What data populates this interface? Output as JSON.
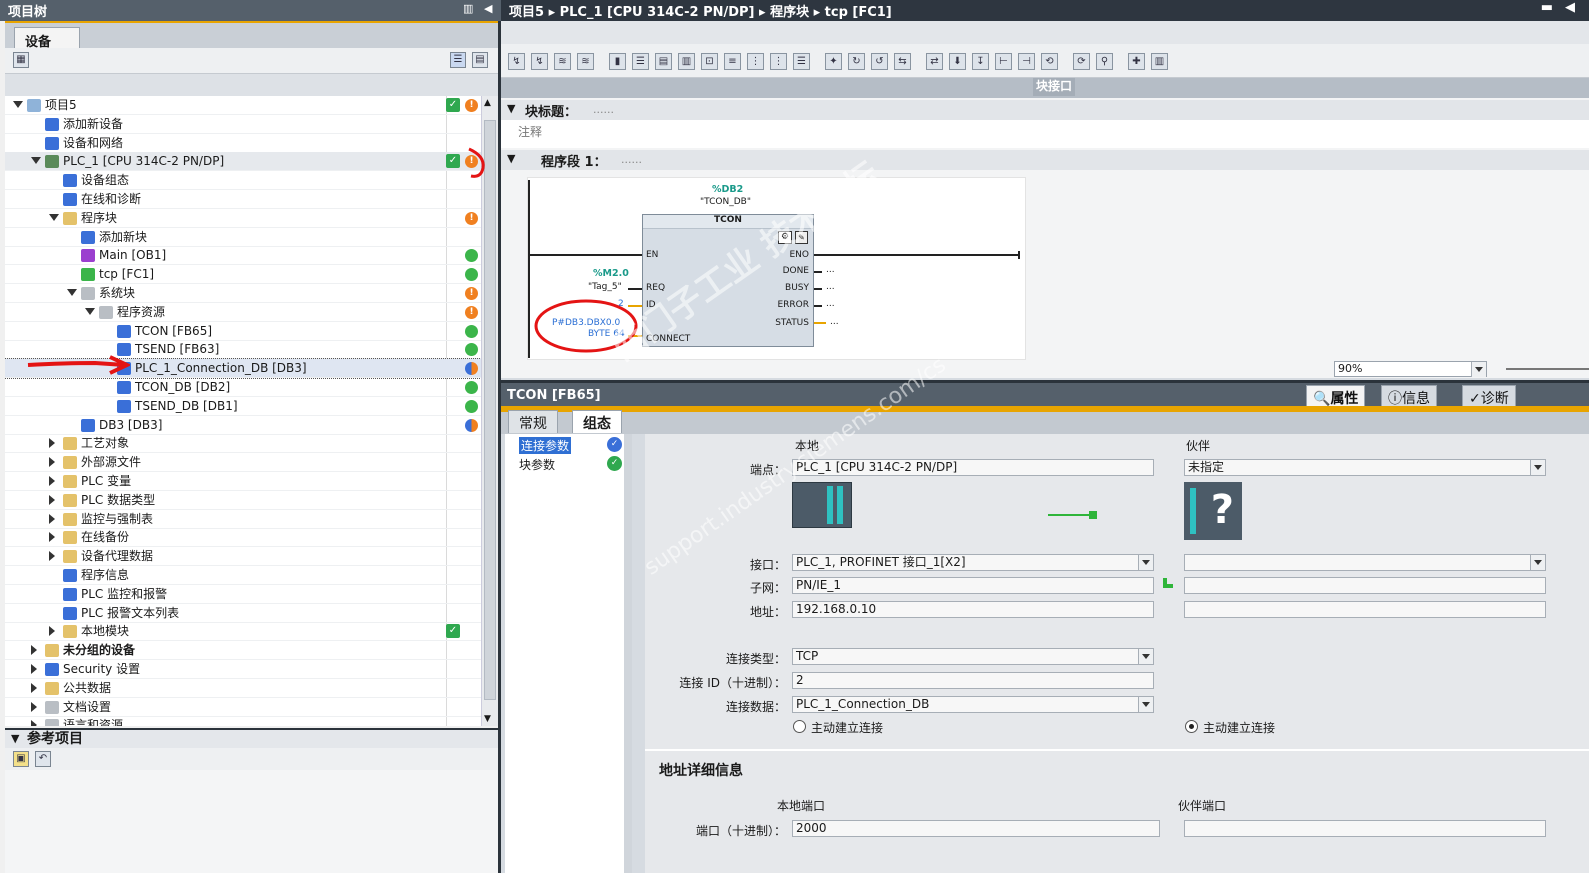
{
  "left": {
    "title": "项目树",
    "tab": "设备",
    "tree": [
      {
        "label": "项目5",
        "indent": 0,
        "tw": "open",
        "icon": "project-icon",
        "icolor": "#8fb3d9",
        "st": "chk",
        "st2": "warn"
      },
      {
        "label": "添加新设备",
        "indent": 1,
        "tw": "",
        "icon": "add-device-icon",
        "icolor": "#3a6fd8",
        "st": "",
        "st2": ""
      },
      {
        "label": "设备和网络",
        "indent": 1,
        "tw": "",
        "icon": "network-icon",
        "icolor": "#3a6fd8",
        "st": "",
        "st2": ""
      },
      {
        "label": "PLC_1 [CPU 314C-2 PN/DP]",
        "indent": 1,
        "tw": "open",
        "icon": "plc-icon",
        "icolor": "#5a8a5a",
        "st": "chk",
        "st2": "warn",
        "sel": true
      },
      {
        "label": "设备组态",
        "indent": 2,
        "tw": "",
        "icon": "device-config-icon",
        "icolor": "#3a6fd8",
        "st": "",
        "st2": ""
      },
      {
        "label": "在线和诊断",
        "indent": 2,
        "tw": "",
        "icon": "online-diag-icon",
        "icolor": "#3a6fd8",
        "st": "",
        "st2": ""
      },
      {
        "label": "程序块",
        "indent": 2,
        "tw": "open",
        "icon": "folder-icon",
        "icolor": "#e4c26a",
        "st": "",
        "st2": "warn"
      },
      {
        "label": "添加新块",
        "indent": 3,
        "tw": "",
        "icon": "add-block-icon",
        "icolor": "#3a6fd8",
        "st": "",
        "st2": ""
      },
      {
        "label": "Main [OB1]",
        "indent": 3,
        "tw": "",
        "icon": "ob-icon",
        "icolor": "#9b3fcf",
        "st": "",
        "st2": "ok"
      },
      {
        "label": "tcp [FC1]",
        "indent": 3,
        "tw": "",
        "icon": "fc-icon",
        "icolor": "#3bb54a",
        "st": "",
        "st2": "ok"
      },
      {
        "label": "系统块",
        "indent": 3,
        "tw": "open",
        "icon": "folder-icon",
        "icolor": "#b9bec4",
        "st": "",
        "st2": "warn"
      },
      {
        "label": "程序资源",
        "indent": 4,
        "tw": "open",
        "icon": "folder-icon",
        "icolor": "#b9bec4",
        "st": "",
        "st2": "warn"
      },
      {
        "label": "TCON [FB65]",
        "indent": 5,
        "tw": "",
        "icon": "fb-icon",
        "icolor": "#3a6fd8",
        "st": "",
        "st2": "ok"
      },
      {
        "label": "TSEND [FB63]",
        "indent": 5,
        "tw": "",
        "icon": "fb-icon",
        "icolor": "#3a6fd8",
        "st": "",
        "st2": "ok"
      },
      {
        "label": "PLC_1_Connection_DB [DB3]",
        "indent": 5,
        "tw": "",
        "icon": "db-icon",
        "icolor": "#3a6fd8",
        "st": "",
        "st2": "half",
        "dash": true
      },
      {
        "label": "TCON_DB [DB2]",
        "indent": 5,
        "tw": "",
        "icon": "db-icon",
        "icolor": "#3a6fd8",
        "st": "",
        "st2": "ok"
      },
      {
        "label": "TSEND_DB [DB1]",
        "indent": 5,
        "tw": "",
        "icon": "db-icon",
        "icolor": "#3a6fd8",
        "st": "",
        "st2": "ok"
      },
      {
        "label": "DB3 [DB3]",
        "indent": 3,
        "tw": "",
        "icon": "db-icon",
        "icolor": "#3a6fd8",
        "st": "",
        "st2": "half"
      },
      {
        "label": "工艺对象",
        "indent": 2,
        "tw": "closed",
        "icon": "folder-icon",
        "icolor": "#e4c26a",
        "st": "",
        "st2": ""
      },
      {
        "label": "外部源文件",
        "indent": 2,
        "tw": "closed",
        "icon": "folder-icon",
        "icolor": "#e4c26a",
        "st": "",
        "st2": ""
      },
      {
        "label": "PLC 变量",
        "indent": 2,
        "tw": "closed",
        "icon": "folder-icon",
        "icolor": "#e4c26a",
        "st": "",
        "st2": ""
      },
      {
        "label": "PLC 数据类型",
        "indent": 2,
        "tw": "closed",
        "icon": "folder-icon",
        "icolor": "#e4c26a",
        "st": "",
        "st2": ""
      },
      {
        "label": "监控与强制表",
        "indent": 2,
        "tw": "closed",
        "icon": "folder-icon",
        "icolor": "#e4c26a",
        "st": "",
        "st2": ""
      },
      {
        "label": "在线备份",
        "indent": 2,
        "tw": "closed",
        "icon": "folder-icon",
        "icolor": "#e4c26a",
        "st": "",
        "st2": ""
      },
      {
        "label": "设备代理数据",
        "indent": 2,
        "tw": "closed",
        "icon": "folder-icon",
        "icolor": "#e4c26a",
        "st": "",
        "st2": ""
      },
      {
        "label": "程序信息",
        "indent": 2,
        "tw": "",
        "icon": "info-icon",
        "icolor": "#3a6fd8",
        "st": "",
        "st2": ""
      },
      {
        "label": "PLC 监控和报警",
        "indent": 2,
        "tw": "",
        "icon": "alarm-icon",
        "icolor": "#3a6fd8",
        "st": "",
        "st2": ""
      },
      {
        "label": "PLC 报警文本列表",
        "indent": 2,
        "tw": "",
        "icon": "text-list-icon",
        "icolor": "#3a6fd8",
        "st": "",
        "st2": ""
      },
      {
        "label": "本地模块",
        "indent": 2,
        "tw": "closed",
        "icon": "folder-icon",
        "icolor": "#e4c26a",
        "st": "chk",
        "st2": ""
      },
      {
        "label": "未分组的设备",
        "indent": 1,
        "tw": "closed",
        "icon": "folder-icon",
        "icolor": "#e4c26a",
        "st": "",
        "st2": "",
        "bold": true
      },
      {
        "label": "Security 设置",
        "indent": 1,
        "tw": "closed",
        "icon": "security-icon",
        "icolor": "#3a6fd8",
        "st": "",
        "st2": ""
      },
      {
        "label": "公共数据",
        "indent": 1,
        "tw": "closed",
        "icon": "folder-icon",
        "icolor": "#e4c26a",
        "st": "",
        "st2": ""
      },
      {
        "label": "文档设置",
        "indent": 1,
        "tw": "closed",
        "icon": "doc-icon",
        "icolor": "#b9bec4",
        "st": "",
        "st2": ""
      },
      {
        "label": "语言和资源",
        "indent": 1,
        "tw": "closed",
        "icon": "lang-icon",
        "icolor": "#b9bec4",
        "st": "",
        "st2": ""
      }
    ],
    "ref_title": "参考项目"
  },
  "right": {
    "breadcrumb": "项目5 ▸ PLC_1 [CPU 314C-2 PN/DP] ▸ 程序块 ▸ tcp [FC1]",
    "block_interface": "块接口",
    "block_title_label": "块标题：",
    "block_title_dots": "......",
    "comment": "注释",
    "network_label": "程序段 1：",
    "network_dots": "......",
    "fb": {
      "db_name": "%DB2",
      "db_symbol": "\"TCON_DB\"",
      "type": "TCON",
      "en": "EN",
      "eno": "ENO",
      "req": "REQ",
      "id": "ID",
      "connect": "CONNECT",
      "done": "DONE",
      "busy": "BUSY",
      "error": "ERROR",
      "status": "STATUS",
      "req_addr": "%M2.0",
      "req_tag": "\"Tag_5\"",
      "id_val": "2",
      "connect_val1": "P#DB3.DBX0.0",
      "connect_val2": "BYTE 64",
      "out_dots": "...",
      "out_dots2": "...",
      "out_dots3": "...",
      "out_dots4": "..."
    },
    "zoom": "90%"
  },
  "props": {
    "title": "TCON [FB65]",
    "tabs": [
      "属性",
      "信息",
      "诊断"
    ],
    "subtabs": [
      "常规",
      "组态"
    ],
    "nav": [
      "连接参数",
      "块参数"
    ],
    "local_label": "本地",
    "partner_label": "伙伴",
    "endpoint_label": "端点：",
    "endpoint_local": "PLC_1 [CPU 314C-2 PN/DP]",
    "endpoint_partner": "未指定",
    "iface_label": "接口：",
    "iface_local": "PLC_1, PROFINET 接口_1[X2]",
    "subnet_label": "子网：",
    "subnet_local": "PN/IE_1",
    "addr_label": "地址：",
    "addr_local": "192.168.0.10",
    "conn_type_label": "连接类型：",
    "conn_type": "TCP",
    "conn_id_label": "连接 ID（十进制）：",
    "conn_id": "2",
    "conn_data_label": "连接数据：",
    "conn_data": "PLC_1_Connection_DB",
    "active_local": "主动建立连接",
    "active_partner": "主动建立连接",
    "addr_detail_title": "地址详细信息",
    "local_port_label": "本地端口",
    "partner_port_label": "伙伴端口",
    "port_label": "端口（十进制）：",
    "port_local": "2000"
  },
  "watermark": "西门子工业 技术论坛",
  "watermark2": "support.industry.siemens.com/cs"
}
